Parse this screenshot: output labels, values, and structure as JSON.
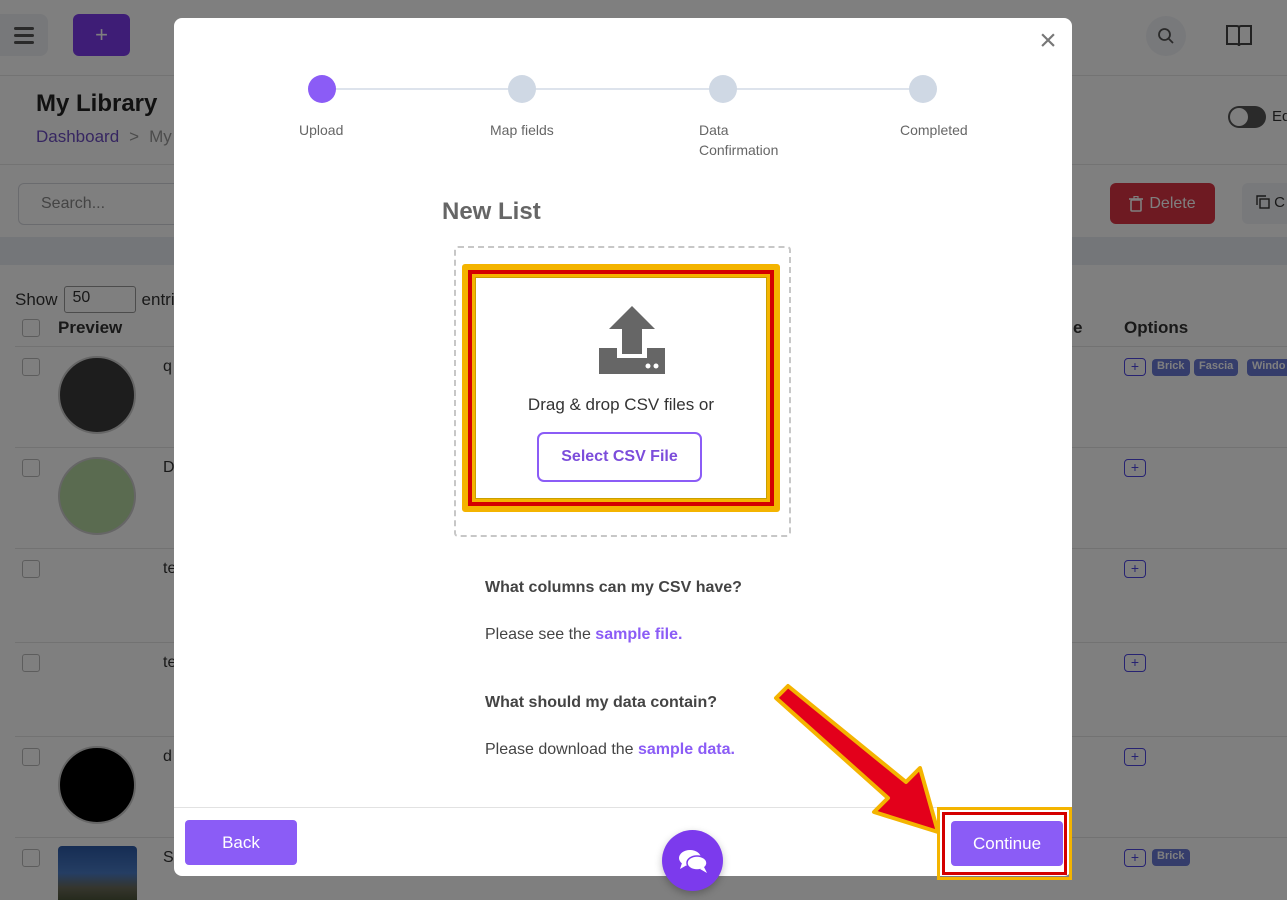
{
  "topbar": {
    "add_label": "+"
  },
  "page": {
    "title": "My Library",
    "breadcrumb_root": "Dashboard",
    "breadcrumb_sep": ">",
    "breadcrumb_current": "My",
    "edit_toggle_label": "Ed"
  },
  "toolbar": {
    "search_placeholder": "Search...",
    "delete_label": "Delete",
    "copy_label": "C"
  },
  "table": {
    "show_label": "Show",
    "show_value": "50",
    "entries_label": "entri",
    "headers": {
      "preview": "Preview",
      "type_partial": "e",
      "options": "Options"
    },
    "rows": [
      {
        "text": "q",
        "tags": [
          "Brick",
          "Fascia",
          "Windo"
        ]
      },
      {
        "text": "D",
        "tags": []
      },
      {
        "text": "te",
        "tags": []
      },
      {
        "text": "te",
        "tags": []
      },
      {
        "text": "d",
        "tags": []
      },
      {
        "text": "S",
        "tags": [
          "Brick"
        ]
      }
    ],
    "plus_label": "+"
  },
  "modal": {
    "close_label": "×",
    "steps": [
      {
        "label": "Upload",
        "active": true
      },
      {
        "label": "Map fields",
        "active": false
      },
      {
        "label": "Data",
        "label2": "Confirmation",
        "active": false
      },
      {
        "label": "Completed",
        "active": false
      }
    ],
    "title": "New List",
    "drop_text": "Drag & drop CSV files or",
    "select_button": "Select CSV File",
    "faq": {
      "q1": "What columns can my CSV have?",
      "a1_prefix": "Please see the ",
      "a1_link": "sample file.",
      "q2": "What should my data contain?",
      "a2_prefix": "Please download the ",
      "a2_link": "sample data."
    },
    "back_label": "Back",
    "continue_label": "Continue"
  },
  "colors": {
    "accent": "#8b5cf6",
    "highlight_outer": "#f4b400",
    "highlight_inner": "#d40000",
    "delete": "#dc3545"
  }
}
